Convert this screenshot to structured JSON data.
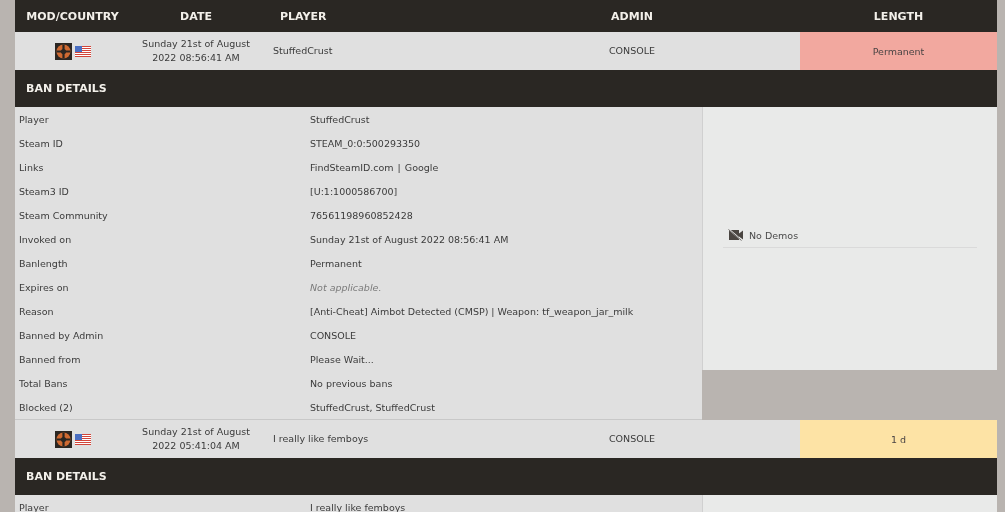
{
  "columns": [
    "MOD/COUNTRY",
    "DATE",
    "PLAYER",
    "ADMIN",
    "LENGTH"
  ],
  "bans": [
    {
      "date": "Sunday 21st of August 2022 08:56:41 AM",
      "player": "StuffedCrust",
      "admin": "CONSOLE",
      "length": "Permanent",
      "color": "#f2a89f",
      "details_title": "BAN DETAILS",
      "details": [
        {
          "kind": "text",
          "label": "Player",
          "value": "StuffedCrust"
        },
        {
          "kind": "text",
          "label": "Steam ID",
          "value": "STEAM_0:0:500293350"
        },
        {
          "kind": "links",
          "label": "Links",
          "links": [
            "FindSteamID.com",
            "Google"
          ],
          "separator": "|"
        },
        {
          "kind": "text",
          "label": "Steam3 ID",
          "value": "[U:1:1000586700]"
        },
        {
          "kind": "text",
          "label": "Steam Community",
          "value": "76561198960852428"
        },
        {
          "kind": "text",
          "label": "Invoked on",
          "value": "Sunday 21st of August 2022 08:56:41 AM"
        },
        {
          "kind": "text",
          "label": "Banlength",
          "value": "Permanent"
        },
        {
          "kind": "note",
          "label": "Expires on",
          "value": "Not applicable."
        },
        {
          "kind": "text",
          "label": "Reason",
          "value": "[Anti-Cheat] Aimbot Detected (CMSP) | Weapon: tf_weapon_jar_milk"
        },
        {
          "kind": "text",
          "label": "Banned by Admin",
          "value": "CONSOLE"
        },
        {
          "kind": "text",
          "label": "Banned from",
          "value": "Please Wait..."
        },
        {
          "kind": "text",
          "label": "Total Bans",
          "value": "No previous bans"
        },
        {
          "kind": "text",
          "label": "Blocked (2)",
          "value": "StuffedCrust, StuffedCrust"
        }
      ],
      "demos": "No Demos"
    },
    {
      "date": "Sunday 21st of August 2022 05:41:04 AM",
      "player": "I really like femboys",
      "admin": "CONSOLE",
      "length": "1 d",
      "color": "#fde3a5",
      "details_title": "BAN DETAILS",
      "details": [
        {
          "kind": "text",
          "label": "Player",
          "value": "I really like femboys"
        }
      ]
    }
  ]
}
